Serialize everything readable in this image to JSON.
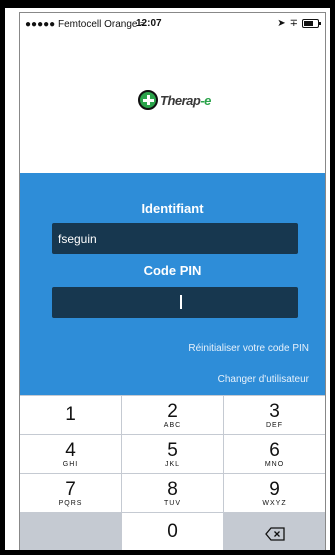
{
  "status_bar": {
    "carrier": "●●●●● Femtocell Orange",
    "time": "12:07"
  },
  "logo": {
    "text": "Therap",
    "suffix": "-e"
  },
  "login": {
    "id_label": "Identifiant",
    "id_value": "fseguin",
    "pin_label": "Code PIN",
    "reset_pin_link": "Réinitialiser votre code PIN",
    "change_user_link": "Changer d'utilisateur"
  },
  "keypad": {
    "keys": [
      {
        "num": "1",
        "letters": ""
      },
      {
        "num": "2",
        "letters": "ABC"
      },
      {
        "num": "3",
        "letters": "DEF"
      },
      {
        "num": "4",
        "letters": "GHI"
      },
      {
        "num": "5",
        "letters": "JKL"
      },
      {
        "num": "6",
        "letters": "MNO"
      },
      {
        "num": "7",
        "letters": "PQRS"
      },
      {
        "num": "8",
        "letters": "TUV"
      },
      {
        "num": "9",
        "letters": "WXYZ"
      },
      {
        "num": "0",
        "letters": ""
      }
    ]
  },
  "colors": {
    "accent_blue": "#2e8dd8",
    "field_dark": "#17374f",
    "logo_green": "#2aa34a"
  }
}
